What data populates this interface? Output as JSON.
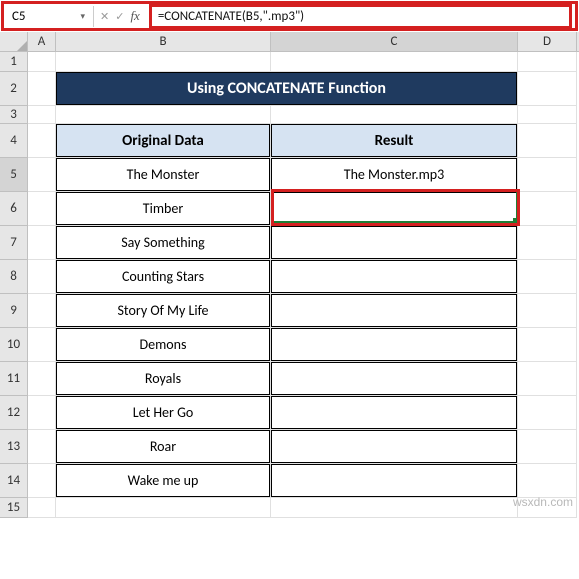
{
  "name_box": {
    "value": "C5"
  },
  "formula_bar": {
    "value": "=CONCATENATE(B5,\".mp3\")"
  },
  "columns": [
    "A",
    "B",
    "C",
    "D"
  ],
  "rows": [
    "1",
    "2",
    "3",
    "4",
    "5",
    "6",
    "7",
    "8",
    "9",
    "10",
    "11",
    "12",
    "13",
    "14",
    "15"
  ],
  "sheet": {
    "title": "Using CONCATENATE Function",
    "headers": {
      "b": "Original Data",
      "c": "Result"
    },
    "data": [
      {
        "b": "The Monster",
        "c": "The Monster.mp3"
      },
      {
        "b": "Timber",
        "c": ""
      },
      {
        "b": "Say Something",
        "c": ""
      },
      {
        "b": "Counting Stars",
        "c": ""
      },
      {
        "b": "Story Of My Life",
        "c": ""
      },
      {
        "b": "Demons",
        "c": ""
      },
      {
        "b": "Royals",
        "c": ""
      },
      {
        "b": "Let Her Go",
        "c": ""
      },
      {
        "b": "Roar",
        "c": ""
      },
      {
        "b": "Wake me up",
        "c": ""
      }
    ]
  },
  "watermark": "wsxdn.com",
  "icons": {
    "dropdown": "▾",
    "cancel": "✕",
    "accept": "✓",
    "fx": "fx"
  }
}
